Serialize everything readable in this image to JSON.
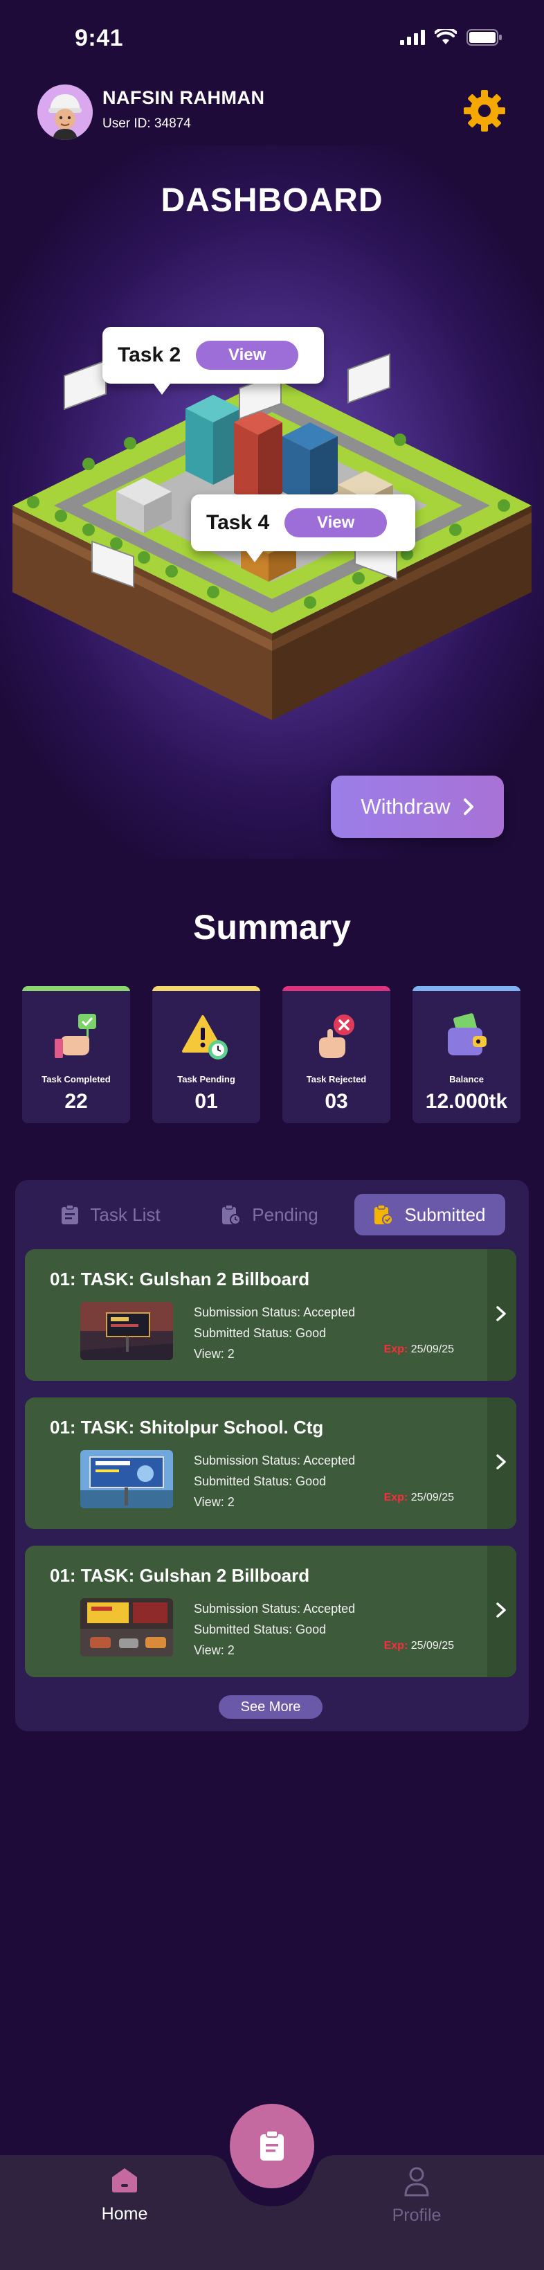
{
  "status_bar": {
    "time": "9:41"
  },
  "user": {
    "name": "NAFSIN RAHMAN",
    "id_text": "User ID: 34874"
  },
  "header": {
    "title": "DASHBOARD"
  },
  "map": {
    "bubbles": [
      {
        "label": "Task 2",
        "button": "View"
      },
      {
        "label": "Task 4",
        "button": "View"
      }
    ]
  },
  "withdraw": {
    "label": "Withdraw"
  },
  "summary": {
    "title": "Summary",
    "cards": [
      {
        "label": "Task Completed",
        "value": "22",
        "accent": "#8bd66e"
      },
      {
        "label": "Task Pending",
        "value": "01",
        "accent": "#f5d86b"
      },
      {
        "label": "Task Rejected",
        "value": "03",
        "accent": "#e0337f"
      },
      {
        "label": "Balance",
        "value": "12.000tk",
        "accent": "#7fb2f0"
      }
    ]
  },
  "tabs": [
    {
      "label": "Task List",
      "icon": "clipboard-icon",
      "active": false
    },
    {
      "label": "Pending",
      "icon": "clipboard-clock-icon",
      "active": false
    },
    {
      "label": "Submitted",
      "icon": "clipboard-check-icon",
      "active": true
    }
  ],
  "tasks": [
    {
      "title": "01: TASK: Gulshan 2 Billboard",
      "submission_status": "Submission Status: Accepted",
      "submitted_status": "Submitted Status: Good",
      "view": "View: 2",
      "exp_label": "Exp:",
      "exp_date": "25/09/25"
    },
    {
      "title": "01: TASK: Shitolpur School. Ctg",
      "submission_status": "Submission Status: Accepted",
      "submitted_status": "Submitted Status: Good",
      "view": "View: 2",
      "exp_label": "Exp:",
      "exp_date": "25/09/25"
    },
    {
      "title": "01: TASK: Gulshan 2 Billboard",
      "submission_status": "Submission Status: Accepted",
      "submitted_status": "Submitted Status: Good",
      "view": "View: 2",
      "exp_label": "Exp:",
      "exp_date": "25/09/25"
    }
  ],
  "see_more": "See More",
  "nav": {
    "home": "Home",
    "profile": "Profile"
  },
  "colors": {
    "background": "#1e0b3a",
    "panel": "#2d1d52",
    "accent": "#9d6dd8",
    "task_card": "#3d5a3a",
    "exp_red": "#ff2b3a",
    "gear": "#f5a800"
  }
}
